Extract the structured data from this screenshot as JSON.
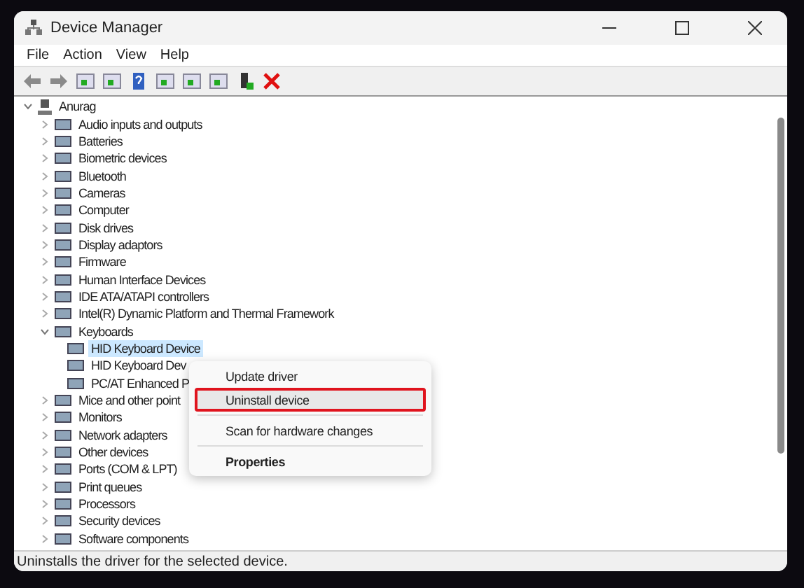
{
  "window": {
    "title": "Device Manager"
  },
  "menu_bar": [
    "File",
    "Action",
    "View",
    "Help"
  ],
  "tree": {
    "label": "Anurag",
    "expanded": true,
    "children": [
      {
        "label": "Audio inputs and outputs",
        "expanded": false
      },
      {
        "label": "Batteries",
        "expanded": false
      },
      {
        "label": "Biometric devices",
        "expanded": false
      },
      {
        "label": "Bluetooth",
        "expanded": false
      },
      {
        "label": "Cameras",
        "expanded": false
      },
      {
        "label": "Computer",
        "expanded": false
      },
      {
        "label": "Disk drives",
        "expanded": false
      },
      {
        "label": "Display adaptors",
        "expanded": false
      },
      {
        "label": "Firmware",
        "expanded": false
      },
      {
        "label": "Human Interface Devices",
        "expanded": false
      },
      {
        "label": "IDE ATA/ATAPI controllers",
        "expanded": false
      },
      {
        "label": "Intel(R) Dynamic Platform and Thermal Framework",
        "expanded": false
      },
      {
        "label": "Keyboards",
        "expanded": true,
        "children": [
          {
            "label": "HID Keyboard Device",
            "selected": true
          },
          {
            "label": "HID Keyboard Dev",
            "selected": false
          },
          {
            "label": "PC/AT Enhanced P",
            "selected": false
          }
        ]
      },
      {
        "label": "Mice and other point",
        "expanded": false
      },
      {
        "label": "Monitors",
        "expanded": false
      },
      {
        "label": "Network adapters",
        "expanded": false
      },
      {
        "label": "Other devices",
        "expanded": false
      },
      {
        "label": "Ports (COM & LPT)",
        "expanded": false
      },
      {
        "label": "Print queues",
        "expanded": false
      },
      {
        "label": "Processors",
        "expanded": false
      },
      {
        "label": "Security devices",
        "expanded": false
      },
      {
        "label": "Software components",
        "expanded": false
      }
    ]
  },
  "context_menu": [
    {
      "label": "Update driver",
      "bold": false,
      "highlighted": false,
      "separator_before": false
    },
    {
      "label": "Uninstall device",
      "bold": false,
      "highlighted": true,
      "separator_before": false
    },
    {
      "label": "Scan for hardware changes",
      "bold": false,
      "highlighted": false,
      "separator_before": true
    },
    {
      "label": "Properties",
      "bold": true,
      "highlighted": false,
      "separator_before": true
    }
  ],
  "status_bar": "Uninstalls the driver for the selected device."
}
